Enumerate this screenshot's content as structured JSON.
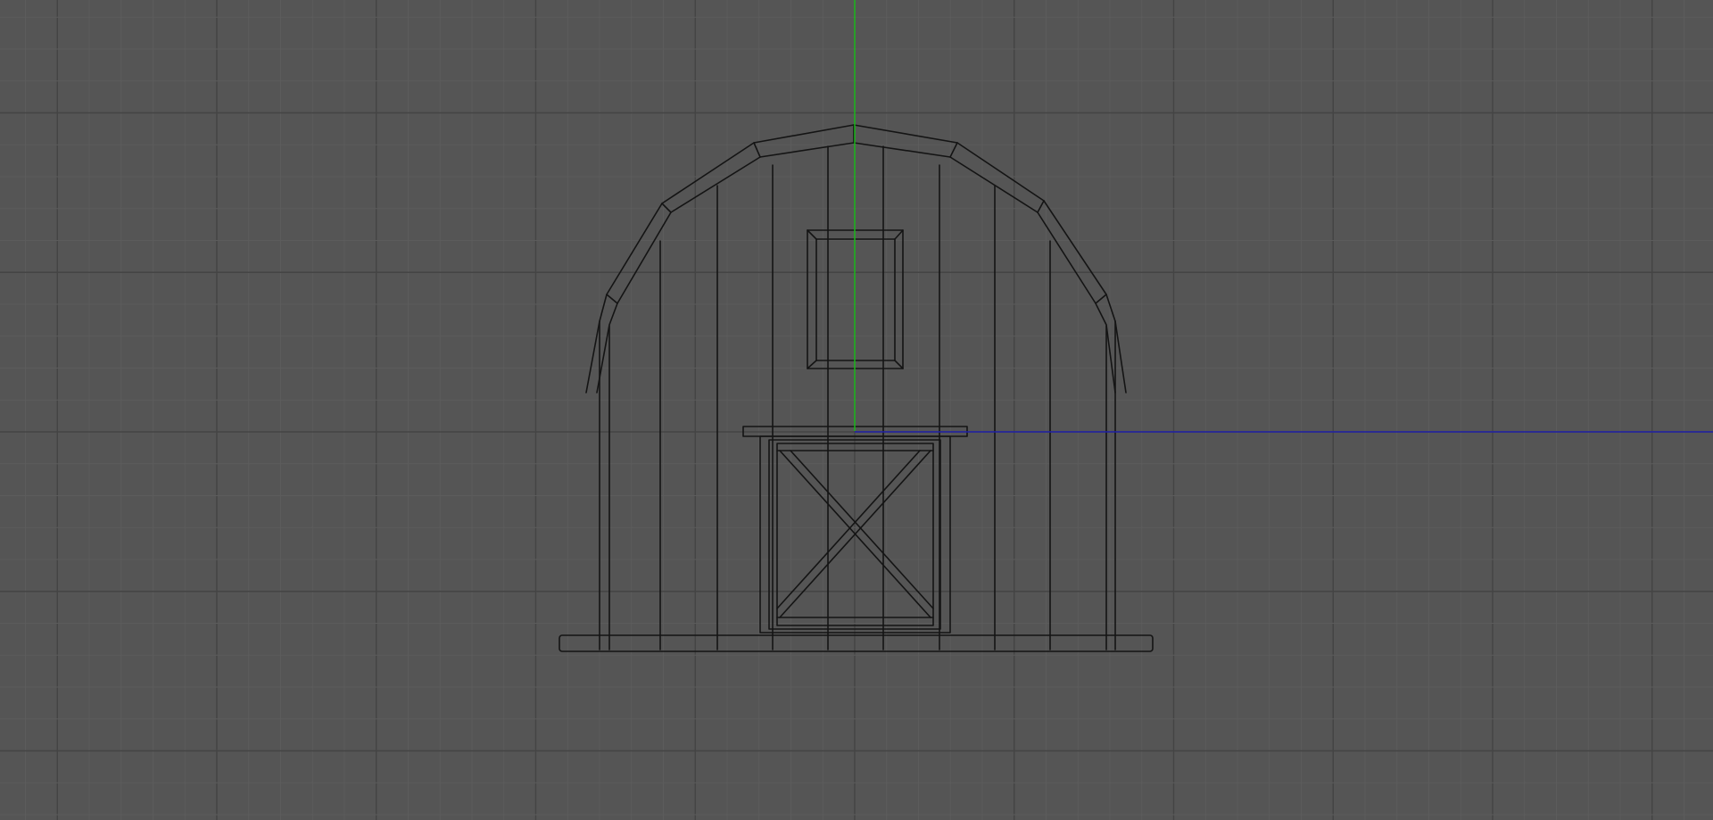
{
  "viewport": {
    "view": "3d-viewport-wireframe",
    "background_color": "#555555",
    "grid_minor_color": "#5c5c5c",
    "grid_major_color": "#444444",
    "y_axis_color": "#18c018",
    "x_axis_color": "#2020a8",
    "wire_color": "#141414"
  },
  "scene_object": {
    "name": "barn",
    "parts": [
      "arched-roof",
      "wall-planks",
      "window",
      "door",
      "door-header",
      "base"
    ]
  }
}
